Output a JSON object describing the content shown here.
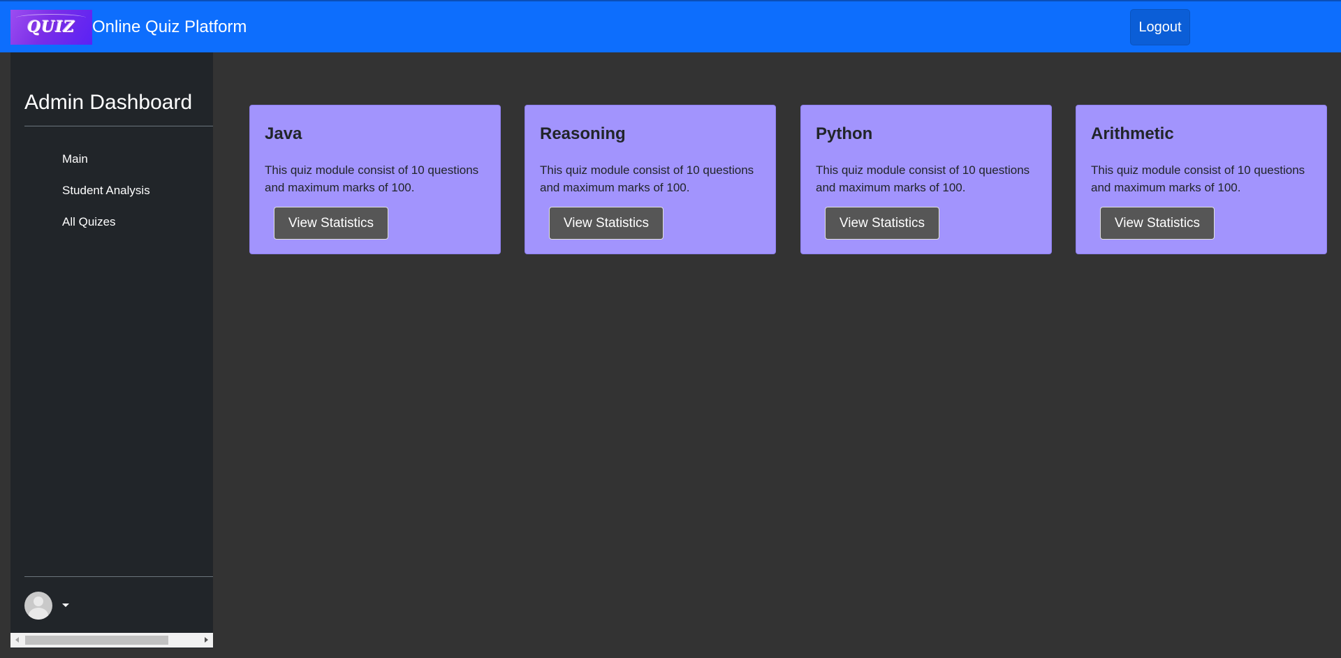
{
  "navbar": {
    "logo_text": "QUIZ",
    "brand_title": "Online Quiz Platform",
    "logout_label": "Logout",
    "background_color": "#0d6efd"
  },
  "sidebar": {
    "title": "Admin Dashboard",
    "items": [
      {
        "label": "Main"
      },
      {
        "label": "Student Analysis"
      },
      {
        "label": "All Quizes"
      }
    ],
    "background_color": "#212529"
  },
  "cards": [
    {
      "title": "Java",
      "text": "This quiz module consist of 10 questions and maximum marks of 100.",
      "button_label": "View Statistics"
    },
    {
      "title": "Reasoning",
      "text": "This quiz module consist of 10 questions and maximum marks of 100.",
      "button_label": "View Statistics"
    },
    {
      "title": "Python",
      "text": "This quiz module consist of 10 questions and maximum marks of 100.",
      "button_label": "View Statistics"
    },
    {
      "title": "Arithmetic",
      "text": "This quiz module consist of 10 questions and maximum marks of 100.",
      "button_label": "View Statistics"
    }
  ],
  "colors": {
    "card_background": "#a294fd",
    "page_background": "#333333",
    "button_background": "#565656"
  },
  "icons": {
    "avatar": "user-avatar-icon",
    "dropdown": "caret-down-icon"
  }
}
